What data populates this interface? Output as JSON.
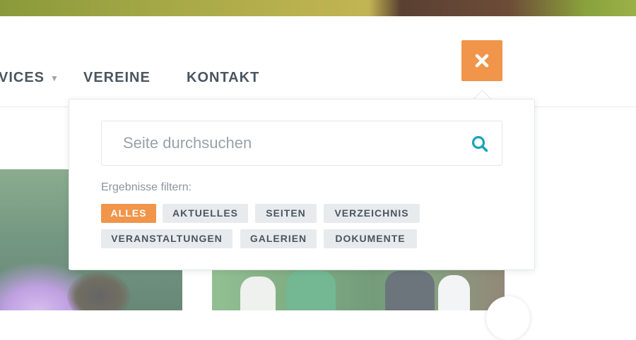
{
  "nav": {
    "items": [
      "VICES",
      "VEREINE",
      "KONTAKT"
    ],
    "caret": "▼"
  },
  "search": {
    "placeholder": "Seite durchsuchen",
    "filter_label": "Ergebnisse filtern:",
    "filters": [
      "ALLES",
      "AKTUELLES",
      "SEITEN",
      "VERZEICHNIS",
      "VERANSTALTUNGEN",
      "GALERIEN",
      "DOKUMENTE"
    ],
    "active_filter": "ALLES"
  },
  "colors": {
    "accent": "#f0954a",
    "search_icon": "#1aa3b8",
    "nav_text": "#4a5560"
  },
  "icons": {
    "close": "close-icon",
    "search": "search-icon"
  }
}
